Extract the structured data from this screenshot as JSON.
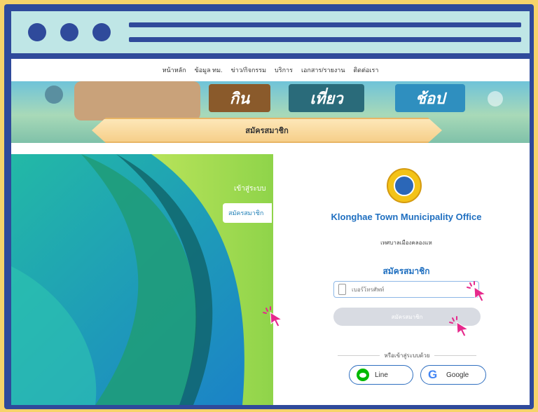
{
  "nav": {
    "items": [
      "หน้าหลัก",
      "ข้อมูล ทม.",
      "ข่าว/กิจกรรม",
      "บริการ",
      "เอกสาร/รายงาน",
      "ติดต่อเรา"
    ]
  },
  "banner": {
    "signs": [
      "กิน",
      "เที่ยว",
      "ช้อป"
    ],
    "ribbon_title": "สมัครสมาชิก"
  },
  "side_tabs": {
    "login": "เข้าสู่ระบบ",
    "register": "สมัครสมาชิก"
  },
  "org": {
    "name_en": "Klonghae Town Municipality Office",
    "name_th": "เทศบาลเมืองคลองแห"
  },
  "form": {
    "title": "สมัครสมาชิก",
    "phone_placeholder": "เบอร์โทรศัพท์",
    "submit_label": "สมัครสมาชิก",
    "or_login_with": "หรือเข้าสู่ระบบด้วย",
    "line_label": "Line",
    "google_label": "Google"
  },
  "icons": {
    "phone": "phone-icon",
    "line": "line-icon",
    "google": "google-icon",
    "cursor": "pointer-cursor-icon"
  },
  "colors": {
    "frame": "#2f4a9b",
    "titlebar": "#bfe6e6",
    "accent": "#1f6fc0",
    "cursor": "#e6298c"
  }
}
